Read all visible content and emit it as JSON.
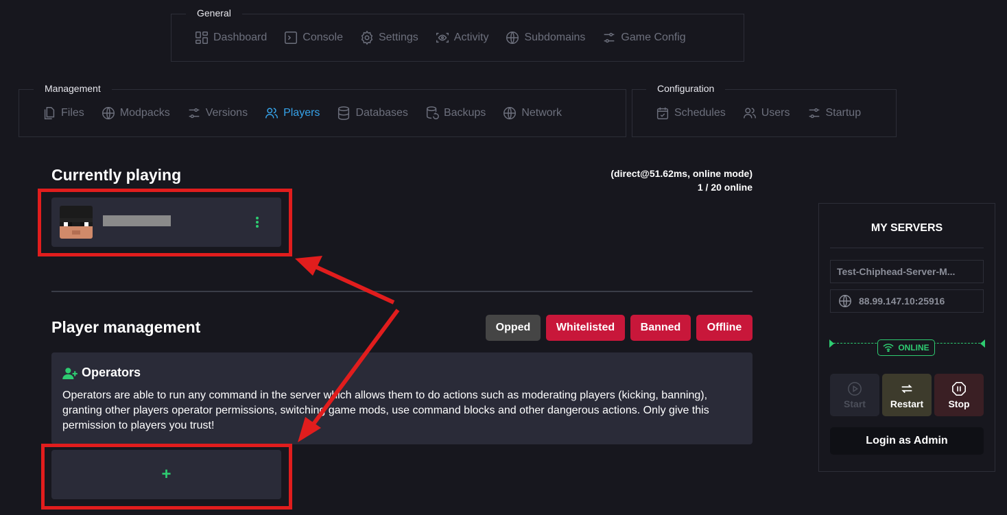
{
  "nav_general": {
    "title": "General",
    "items": [
      {
        "label": "Dashboard"
      },
      {
        "label": "Console"
      },
      {
        "label": "Settings"
      },
      {
        "label": "Activity"
      },
      {
        "label": "Subdomains"
      },
      {
        "label": "Game Config"
      }
    ]
  },
  "nav_management": {
    "title": "Management",
    "items": [
      {
        "label": "Files"
      },
      {
        "label": "Modpacks"
      },
      {
        "label": "Versions"
      },
      {
        "label": "Players",
        "active": true
      },
      {
        "label": "Databases"
      },
      {
        "label": "Backups"
      },
      {
        "label": "Network"
      }
    ]
  },
  "nav_configuration": {
    "title": "Configuration",
    "items": [
      {
        "label": "Schedules"
      },
      {
        "label": "Users"
      },
      {
        "label": "Startup"
      }
    ]
  },
  "currently_playing": {
    "title": "Currently playing",
    "connection": "(direct@51.62ms, online mode)",
    "online_count": "1 / 20 online"
  },
  "player_management": {
    "title": "Player management",
    "filters": [
      {
        "label": "Opped",
        "color": "#454545"
      },
      {
        "label": "Whitelisted",
        "color": "#c8173a"
      },
      {
        "label": "Banned",
        "color": "#c8173a"
      },
      {
        "label": "Offline",
        "color": "#c8173a"
      }
    ],
    "operators_title": "Operators",
    "operators_description": "Operators are able to run any command in the server which allows them to do actions such as moderating players (kicking, banning), granting other players operator permissions, switching game mods, use command blocks and other dangerous actions. Only give this permission to players you trust!",
    "add_label": "+"
  },
  "servers_panel": {
    "title": "MY SERVERS",
    "server_name": "Test-Chiphead-Server-M...",
    "address": "88.99.147.10:25916",
    "status": "ONLINE",
    "start_label": "Start",
    "restart_label": "Restart",
    "stop_label": "Stop",
    "admin_label": "Login as Admin"
  },
  "colors": {
    "accent_active": "#36a3ea",
    "online_green": "#2ecc71",
    "danger_red": "#c8173a",
    "annotation_red": "#e11d1d"
  }
}
